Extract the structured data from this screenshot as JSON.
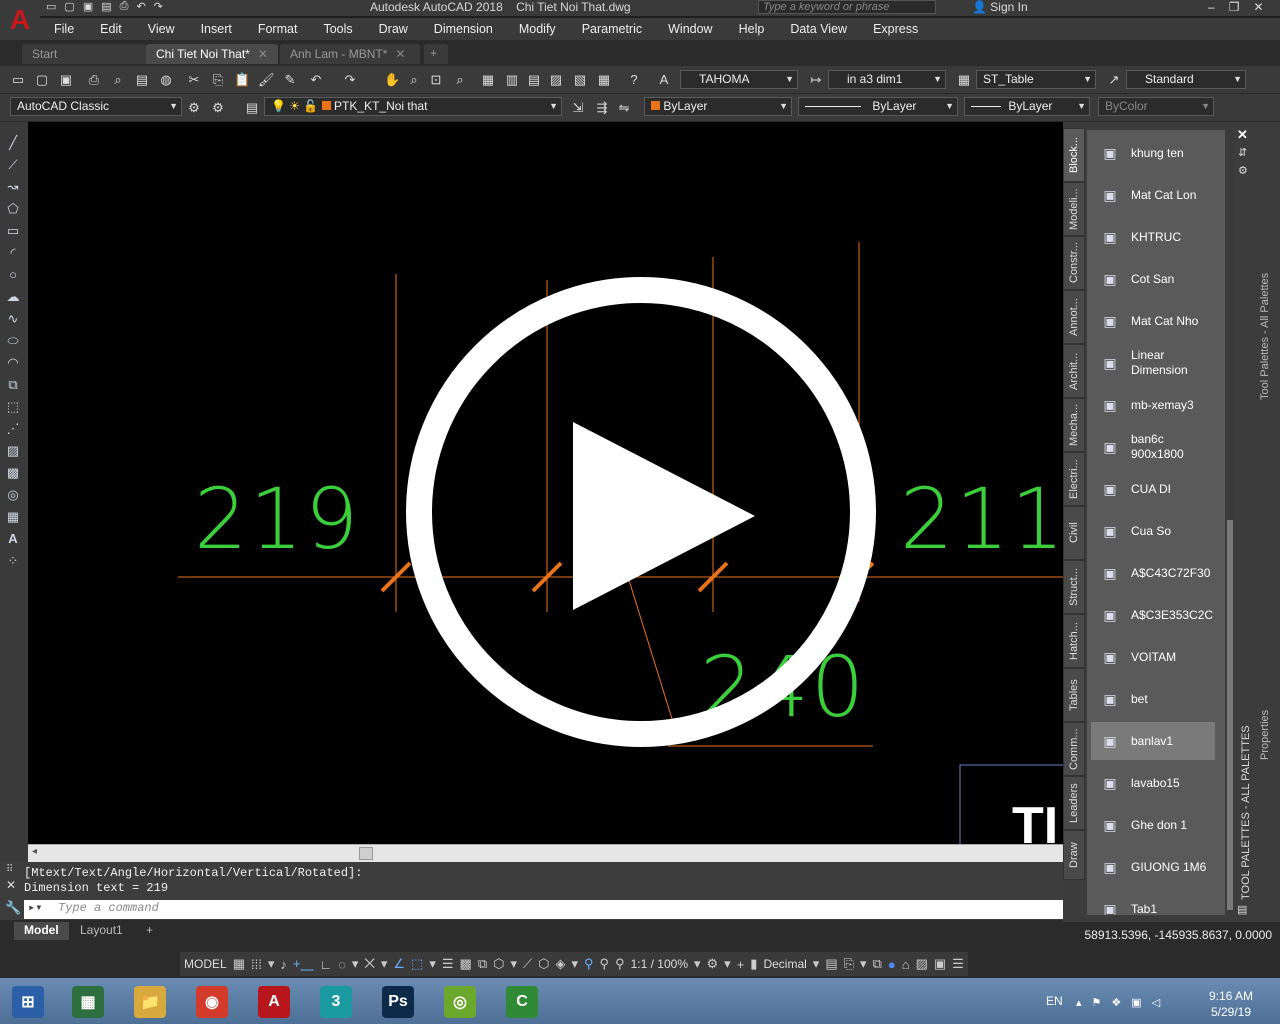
{
  "app": {
    "title": "Autodesk AutoCAD 2018    Chi Tiet Noi That.dwg",
    "logo": "A",
    "search_placeholder": "Type a keyword or phrase",
    "signin": "Sign In"
  },
  "menu": [
    "File",
    "Edit",
    "View",
    "Insert",
    "Format",
    "Tools",
    "Draw",
    "Dimension",
    "Modify",
    "Parametric",
    "Window",
    "Help",
    "Data View",
    "Express"
  ],
  "doc_tabs": [
    {
      "label": "Start",
      "active": false
    },
    {
      "label": "Chi Tiet Noi That*",
      "active": true
    },
    {
      "label": "Anh Lam - MBNT*",
      "active": false
    }
  ],
  "toolbar1": {
    "text_style": "TAHOMA",
    "dim_style": "in a3 dim1",
    "table_style": "ST_Table",
    "multileader_style": "Standard"
  },
  "toolbar2": {
    "workspace": "AutoCAD Classic",
    "layer": "PTK_KT_Noi that",
    "color": "ByLayer",
    "linetype": "ByLayer",
    "lineweight": "ByLayer",
    "plot_style": "ByColor"
  },
  "drawing": {
    "dim_left": "219",
    "dim_right": "211",
    "dim_bottom": "240",
    "title_fragment": "TI"
  },
  "command": {
    "history_line1": "[Mtext/Text/Angle/Horizontal/Vertical/Rotated]:",
    "history_line2": "Dimension text = 219",
    "placeholder": "Type a command"
  },
  "layout_tabs": [
    {
      "label": "Model",
      "active": true
    },
    {
      "label": "Layout1",
      "active": false
    }
  ],
  "coordinates": "58913.5396, -145935.8637, 0.0000",
  "status": {
    "model": "MODEL",
    "scale": "1:1 / 100%",
    "units": "Decimal"
  },
  "palette": {
    "title": "TOOL PALETTES - ALL PALETTES",
    "outer_title": "Tool Palettes - All Palettes",
    "properties": "Properties",
    "side_tabs": [
      "Block...",
      "Modeli...",
      "Constr...",
      "Annot...",
      "Archit...",
      "Mecha...",
      "Electri...",
      "Civil",
      "Struct...",
      "Hatch...",
      "Tables",
      "Comm...",
      "Leaders",
      "Draw"
    ],
    "items": [
      {
        "label": "khung ten",
        "icon": "rectangle-block-icon"
      },
      {
        "label": "Mat Cat Lon",
        "icon": "section-marker-icon"
      },
      {
        "label": "KHTRUC",
        "icon": "axis-marker-icon"
      },
      {
        "label": "Cot San",
        "icon": "level-marker-icon"
      },
      {
        "label": "Mat Cat Nho",
        "icon": "small-section-icon"
      },
      {
        "label": "Linear Dimension",
        "icon": "linear-dimension-icon"
      },
      {
        "label": "mb-xemay3",
        "icon": "motorbike-icon"
      },
      {
        "label": "ban6c 900x1800",
        "icon": "table-chairs-icon"
      },
      {
        "label": "CUA DI",
        "icon": "door-icon"
      },
      {
        "label": "Cua So",
        "icon": "window-icon"
      },
      {
        "label": "A$C43C72F30",
        "icon": "block-icon"
      },
      {
        "label": "A$C3E353C2C",
        "icon": "block-icon"
      },
      {
        "label": "VOITAM",
        "icon": "shower-icon"
      },
      {
        "label": "bet",
        "icon": "toilet-icon"
      },
      {
        "label": "banlav1",
        "icon": "vanity-icon"
      },
      {
        "label": "lavabo15",
        "icon": "basin-icon"
      },
      {
        "label": "Ghe don 1",
        "icon": "chair-icon"
      },
      {
        "label": "GIUONG 1M6",
        "icon": "bed-icon"
      },
      {
        "label": "Tab1",
        "icon": "tab-block-icon"
      }
    ],
    "selected": "banlav1"
  },
  "taskbar": {
    "time": "9:16 AM",
    "date": "5/29/19",
    "lang": "EN",
    "apps": [
      {
        "name": "start-button",
        "glyph": "⊞",
        "color": "#2b5fa8"
      },
      {
        "name": "task-manager",
        "glyph": "▦",
        "color": "#2e6d3e"
      },
      {
        "name": "file-explorer",
        "glyph": "📁",
        "color": "#d8a93c"
      },
      {
        "name": "chrome",
        "glyph": "◉",
        "color": "#d33a2c"
      },
      {
        "name": "autocad",
        "glyph": "A",
        "color": "#b7161c"
      },
      {
        "name": "3ds-max",
        "glyph": "3",
        "color": "#1a9aa0"
      },
      {
        "name": "photoshop",
        "glyph": "Ps",
        "color": "#0d2a4a"
      },
      {
        "name": "app-green",
        "glyph": "◎",
        "color": "#6aa92c"
      },
      {
        "name": "camtasia",
        "glyph": "C",
        "color": "#2e8a34"
      }
    ]
  }
}
